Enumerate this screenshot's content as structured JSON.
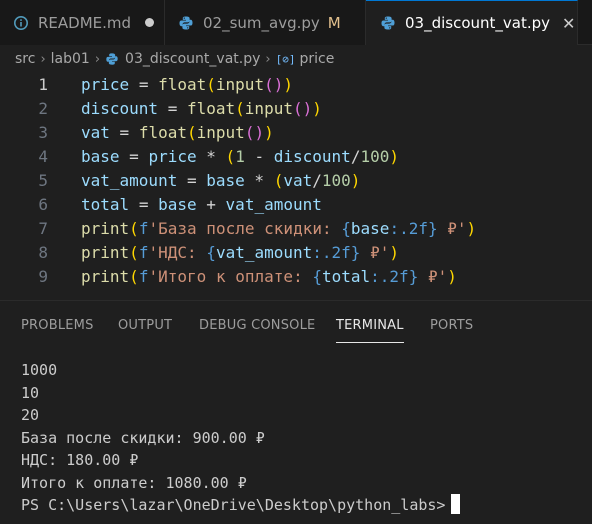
{
  "tabs": [
    {
      "label": "README.md",
      "icon": "info-icon",
      "status": "unsaved-dot"
    },
    {
      "label": "02_sum_avg.py",
      "icon": "python-icon",
      "status": "M"
    },
    {
      "label": "03_discount_vat.py",
      "icon": "python-icon",
      "status": "close"
    }
  ],
  "breadcrumb": {
    "parts": [
      "src",
      "lab01",
      "03_discount_vat.py",
      "price"
    ],
    "symbol_glyph": "[⊘]"
  },
  "editor": {
    "active_line": 1,
    "lines": [
      {
        "number": "1",
        "text": "price = float(input())"
      },
      {
        "number": "2",
        "text": "discount = float(input())"
      },
      {
        "number": "3",
        "text": "vat = float(input())"
      },
      {
        "number": "4",
        "text": "base = price * (1 - discount/100)"
      },
      {
        "number": "5",
        "text": "vat_amount = base * (vat/100)"
      },
      {
        "number": "6",
        "text": "total = base + vat_amount"
      },
      {
        "number": "7",
        "text": "print(f'База после скидки: {base:.2f} ₽')"
      },
      {
        "number": "8",
        "text": "print(f'НДС: {vat_amount:.2f} ₽')"
      },
      {
        "number": "9",
        "text": "print(f'Итого к оплате: {total:.2f} ₽')"
      }
    ]
  },
  "panel": {
    "tabs": [
      "PROBLEMS",
      "OUTPUT",
      "DEBUG CONSOLE",
      "TERMINAL",
      "PORTS"
    ],
    "active_tab": "TERMINAL",
    "terminal_lines": [
      "1000",
      "10",
      "20",
      "База после скидки: 900.00 ₽",
      "НДС: 180.00 ₽",
      "Итого к оплате: 1080.00 ₽"
    ],
    "prompt": "PS C:\\Users\\lazar\\OneDrive\\Desktop\\python_labs>"
  },
  "colors": {
    "accent": "#0078d4",
    "modified": "#e2c08d",
    "python_icon": "#4f9fd6",
    "info_icon": "#519aba"
  }
}
